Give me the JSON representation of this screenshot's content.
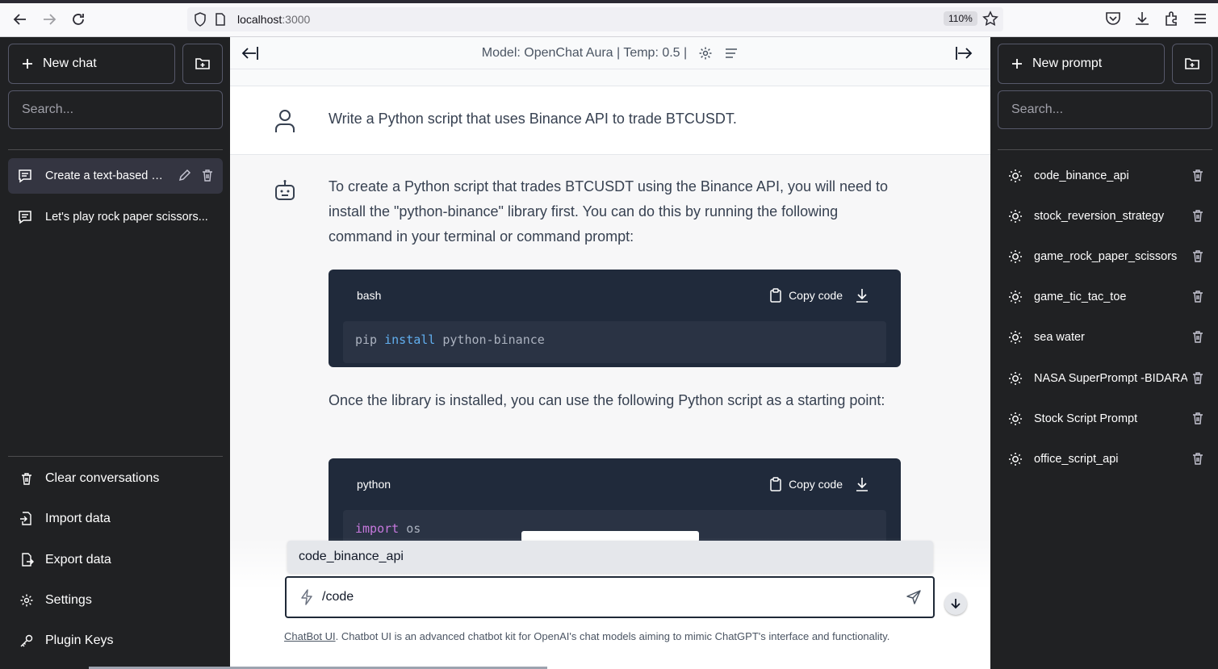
{
  "browser": {
    "url_host": "localhost",
    "url_port": ":3000",
    "zoom": "110%"
  },
  "left_sidebar": {
    "new_chat_label": "New chat",
    "search_placeholder": "Search...",
    "conversations": [
      {
        "label": "Create a text-based e...",
        "active": true
      },
      {
        "label": "Let's play rock paper scissors...",
        "active": false
      }
    ],
    "bottom": {
      "clear": "Clear conversations",
      "import": "Import data",
      "export": "Export data",
      "settings": "Settings",
      "plugin_keys": "Plugin Keys"
    }
  },
  "header": {
    "model_text": "Model: OpenChat Aura | Temp: 0.5 |"
  },
  "messages": {
    "user": "Write a Python script that uses Binance API to trade BTCUSDT.",
    "bot_p1": "To create a Python script that trades BTCUSDT using the Binance API, you will need to install the \"python-binance\" library first. You can do this by running the following command in your terminal or command prompt:",
    "code1": {
      "lang": "bash",
      "copy": "Copy code",
      "tok1": "pip",
      "tok2": "install",
      "tok3": "python-binance"
    },
    "bot_p2": "Once the library is installed, you can use the following Python script as a starting point:",
    "code2": {
      "lang": "python",
      "copy": "Copy code",
      "tok1": "import",
      "tok2": "os"
    }
  },
  "prompt_suggestion": "code_binance_api",
  "chat_input": {
    "value": "/code"
  },
  "footer": {
    "link": "ChatBot UI",
    "text": ". Chatbot UI is an advanced chatbot kit for OpenAI's chat models aiming to mimic ChatGPT's interface and functionality."
  },
  "right_sidebar": {
    "new_prompt_label": "New prompt",
    "search_placeholder": "Search...",
    "prompts": [
      "code_binance_api",
      "stock_reversion_strategy",
      "game_rock_paper_scissors",
      "game_tic_tac_toe",
      "sea water",
      "NASA SuperPrompt -BIDARA",
      "Stock Script Prompt",
      "office_script_api"
    ]
  }
}
